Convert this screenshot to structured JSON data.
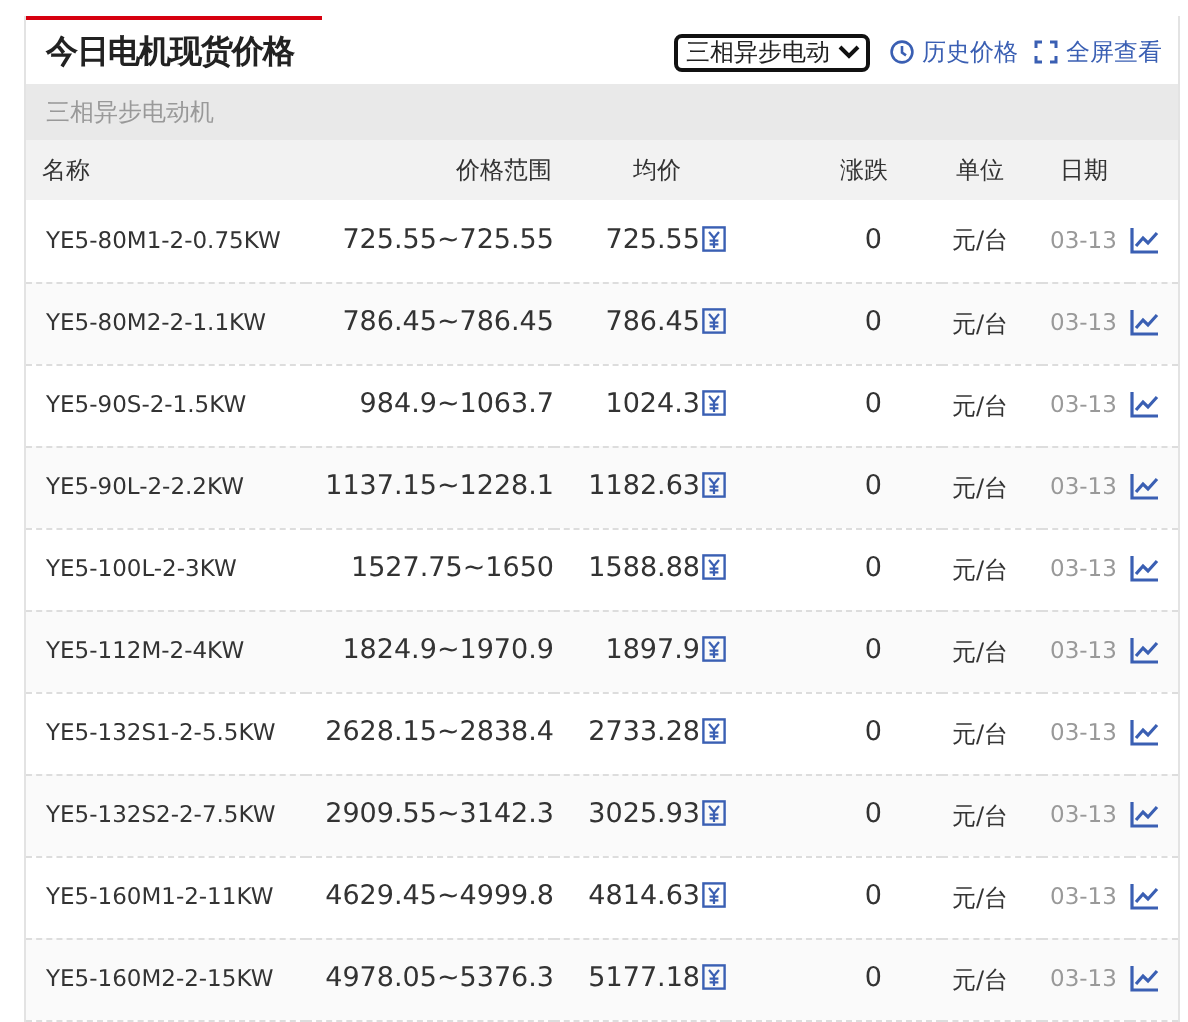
{
  "title": "今日电机现货价格",
  "select": {
    "value": "三相异步电动"
  },
  "links": [
    "历史价格",
    "全屏查看"
  ],
  "category": "三相异步电动机",
  "columns": [
    "名称",
    "价格范围",
    "均价",
    "涨跌",
    "单位",
    "日期"
  ],
  "rows": [
    {
      "name": "YE5-80M1-2-0.75KW",
      "range": "725.55~725.55",
      "avg": "725.55",
      "change": "0",
      "unit": "元/台",
      "date": "03-13"
    },
    {
      "name": "YE5-80M2-2-1.1KW",
      "range": "786.45~786.45",
      "avg": "786.45",
      "change": "0",
      "unit": "元/台",
      "date": "03-13"
    },
    {
      "name": "YE5-90S-2-1.5KW",
      "range": "984.9~1063.7",
      "avg": "1024.3",
      "change": "0",
      "unit": "元/台",
      "date": "03-13"
    },
    {
      "name": "YE5-90L-2-2.2KW",
      "range": "1137.15~1228.1",
      "avg": "1182.63",
      "change": "0",
      "unit": "元/台",
      "date": "03-13"
    },
    {
      "name": "YE5-100L-2-3KW",
      "range": "1527.75~1650",
      "avg": "1588.88",
      "change": "0",
      "unit": "元/台",
      "date": "03-13"
    },
    {
      "name": "YE5-112M-2-4KW",
      "range": "1824.9~1970.9",
      "avg": "1897.9",
      "change": "0",
      "unit": "元/台",
      "date": "03-13"
    },
    {
      "name": "YE5-132S1-2-5.5KW",
      "range": "2628.15~2838.4",
      "avg": "2733.28",
      "change": "0",
      "unit": "元/台",
      "date": "03-13"
    },
    {
      "name": "YE5-132S2-2-7.5KW",
      "range": "2909.55~3142.3",
      "avg": "3025.93",
      "change": "0",
      "unit": "元/台",
      "date": "03-13"
    },
    {
      "name": "YE5-160M1-2-11KW",
      "range": "4629.45~4999.8",
      "avg": "4814.63",
      "change": "0",
      "unit": "元/台",
      "date": "03-13"
    },
    {
      "name": "YE5-160M2-2-15KW",
      "range": "4978.05~5376.3",
      "avg": "5177.18",
      "change": "0",
      "unit": "元/台",
      "date": "03-13"
    }
  ]
}
